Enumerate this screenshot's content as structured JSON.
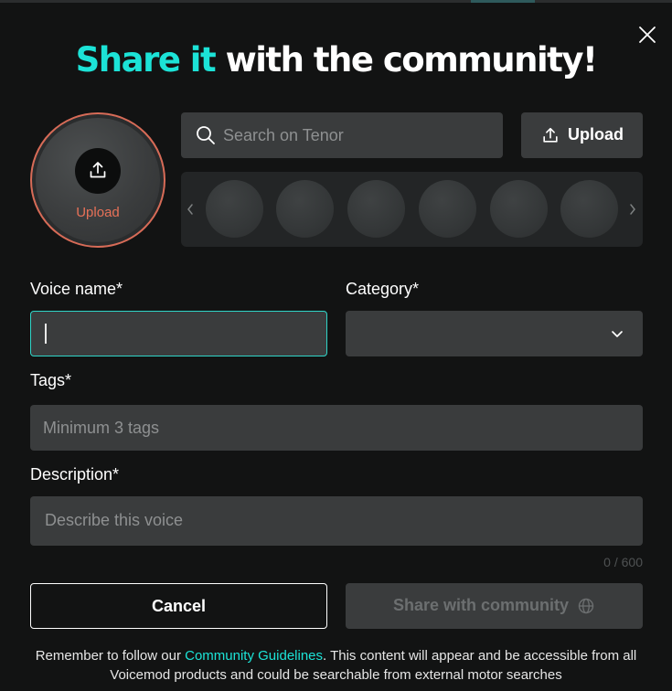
{
  "title": {
    "highlight": "Share it",
    "rest": " with the community!"
  },
  "avatar": {
    "upload_label": "Upload"
  },
  "search": {
    "placeholder": "Search on Tenor"
  },
  "upload_button": {
    "label": "Upload"
  },
  "form": {
    "voice_name_label": "Voice name*",
    "voice_name_value": "",
    "category_label": "Category*",
    "category_value": "",
    "tags_label": "Tags*",
    "tags_placeholder": "Minimum 3 tags",
    "description_label": "Description*",
    "description_placeholder": "Describe this voice",
    "counter": "0 / 600"
  },
  "actions": {
    "cancel": "Cancel",
    "share": "Share with community"
  },
  "footer": {
    "prefix": "Remember to follow our ",
    "link": "Community Guidelines",
    "suffix": ". This content will appear and be accessible from all Voicemod products and could be searchable from external motor searches"
  },
  "colors": {
    "accent": "#1ce3d7",
    "upload_accent": "#e77158",
    "background": "#121313",
    "field": "#3a3c3d"
  },
  "icons": [
    "close-icon",
    "upload-icon",
    "search-icon",
    "chevron-left-icon",
    "chevron-right-icon",
    "chevron-down-icon",
    "globe-icon"
  ]
}
